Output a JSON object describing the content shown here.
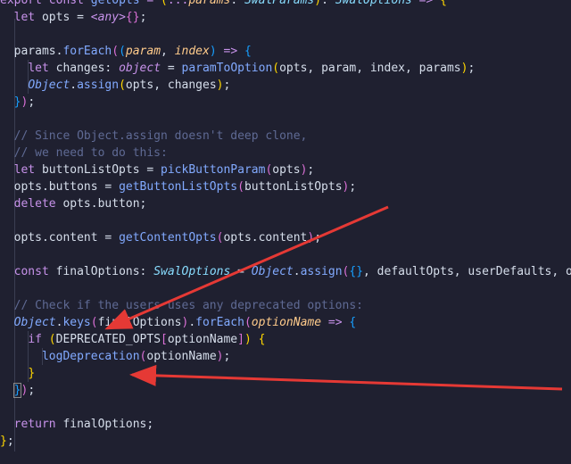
{
  "editor": {
    "theme_colors": {
      "background": "#1f2030",
      "keyword": "#c792ea",
      "function": "#82aaff",
      "type": "#89ddff",
      "parameter": "#ffcb8b",
      "comment": "#5f6a94",
      "annotation_arrow": "#e53935"
    },
    "lines": [
      [
        [
          "kw",
          "export"
        ],
        [
          "pl",
          " "
        ],
        [
          "kw",
          "const"
        ],
        [
          "pl",
          " "
        ],
        [
          "fn",
          "getOpts"
        ],
        [
          "pl",
          " "
        ],
        [
          "op",
          "="
        ],
        [
          "pl",
          " "
        ],
        [
          "pn",
          "("
        ],
        [
          "op",
          "..."
        ],
        [
          "par",
          "params"
        ],
        [
          "pl",
          ": "
        ],
        [
          "ty",
          "SwalParams"
        ],
        [
          "pn",
          ")"
        ],
        [
          "pl",
          ": "
        ],
        [
          "ty",
          "SwalOptions"
        ],
        [
          "pl",
          " "
        ],
        [
          "op",
          "=>"
        ],
        [
          "pl",
          " "
        ],
        [
          "pn",
          "{"
        ]
      ],
      [
        [
          "pl",
          "  "
        ],
        [
          "kw",
          "let"
        ],
        [
          "pl",
          " opts = "
        ],
        [
          "op",
          "<"
        ],
        [
          "kwi",
          "any"
        ],
        [
          "op",
          ">"
        ],
        [
          "pn2",
          "{}"
        ],
        [
          "pl",
          ";"
        ]
      ],
      [
        [
          "pl",
          ""
        ]
      ],
      [
        [
          "pl",
          "  params."
        ],
        [
          "fn",
          "forEach"
        ],
        [
          "pn2",
          "("
        ],
        [
          "pn3",
          "("
        ],
        [
          "par",
          "param"
        ],
        [
          "pl",
          ", "
        ],
        [
          "par",
          "index"
        ],
        [
          "pn3",
          ")"
        ],
        [
          "pl",
          " "
        ],
        [
          "op",
          "=>"
        ],
        [
          "pl",
          " "
        ],
        [
          "pn3",
          "{"
        ]
      ],
      [
        [
          "pl",
          "    "
        ],
        [
          "kw",
          "let"
        ],
        [
          "pl",
          " changes: "
        ],
        [
          "kwi",
          "object"
        ],
        [
          "pl",
          " = "
        ],
        [
          "fn",
          "paramToOption"
        ],
        [
          "pn",
          "("
        ],
        [
          "pl",
          "opts, param, index, params"
        ],
        [
          "pn",
          ")"
        ],
        [
          "pl",
          ";"
        ]
      ],
      [
        [
          "pl",
          "    "
        ],
        [
          "obj",
          "Object"
        ],
        [
          "pl",
          "."
        ],
        [
          "fn",
          "assign"
        ],
        [
          "pn",
          "("
        ],
        [
          "pl",
          "opts, changes"
        ],
        [
          "pn",
          ")"
        ],
        [
          "pl",
          ";"
        ]
      ],
      [
        [
          "pl",
          "  "
        ],
        [
          "pn3",
          "}"
        ],
        [
          "pn2",
          ")"
        ],
        [
          "pl",
          ";"
        ]
      ],
      [
        [
          "pl",
          ""
        ]
      ],
      [
        [
          "cm",
          "  // Since Object.assign doesn't deep clone,"
        ]
      ],
      [
        [
          "cm",
          "  // we need to do this:"
        ]
      ],
      [
        [
          "pl",
          "  "
        ],
        [
          "kw",
          "let"
        ],
        [
          "pl",
          " buttonListOpts = "
        ],
        [
          "fn",
          "pickButtonParam"
        ],
        [
          "pn2",
          "("
        ],
        [
          "pl",
          "opts"
        ],
        [
          "pn2",
          ")"
        ],
        [
          "pl",
          ";"
        ]
      ],
      [
        [
          "pl",
          "  opts.buttons = "
        ],
        [
          "fn",
          "getButtonListOpts"
        ],
        [
          "pn2",
          "("
        ],
        [
          "pl",
          "buttonListOpts"
        ],
        [
          "pn2",
          ")"
        ],
        [
          "pl",
          ";"
        ]
      ],
      [
        [
          "pl",
          "  "
        ],
        [
          "kw",
          "delete"
        ],
        [
          "pl",
          " opts.button;"
        ]
      ],
      [
        [
          "pl",
          ""
        ]
      ],
      [
        [
          "pl",
          "  opts.content = "
        ],
        [
          "fn",
          "getContentOpts"
        ],
        [
          "pn2",
          "("
        ],
        [
          "pl",
          "opts.content"
        ],
        [
          "pn2",
          ")"
        ],
        [
          "pl",
          ";"
        ]
      ],
      [
        [
          "pl",
          ""
        ]
      ],
      [
        [
          "pl",
          "  "
        ],
        [
          "kw",
          "const"
        ],
        [
          "pl",
          " finalOptions: "
        ],
        [
          "ty",
          "SwalOptions"
        ],
        [
          "pl",
          " = "
        ],
        [
          "obj",
          "Object"
        ],
        [
          "pl",
          "."
        ],
        [
          "fn",
          "assign"
        ],
        [
          "pn2",
          "("
        ],
        [
          "pn3",
          "{}"
        ],
        [
          "pl",
          ", defaultOpts, userDefaults, opts"
        ],
        [
          "pn2",
          ")"
        ],
        [
          "pl",
          ";"
        ]
      ],
      [
        [
          "pl",
          ""
        ]
      ],
      [
        [
          "cm",
          "  // Check if the users uses any deprecated options:"
        ]
      ],
      [
        [
          "pl",
          "  "
        ],
        [
          "obj",
          "Object"
        ],
        [
          "pl",
          "."
        ],
        [
          "fn",
          "keys"
        ],
        [
          "pn2",
          "("
        ],
        [
          "pl",
          "finalOptions"
        ],
        [
          "pn2",
          ")"
        ],
        [
          "pl",
          "."
        ],
        [
          "fn",
          "forEach"
        ],
        [
          "pn2",
          "("
        ],
        [
          "par",
          "optionName"
        ],
        [
          "pl",
          " "
        ],
        [
          "op",
          "=>"
        ],
        [
          "pl",
          " "
        ],
        [
          "pn3",
          "{"
        ]
      ],
      [
        [
          "pl",
          "    "
        ],
        [
          "kw",
          "if"
        ],
        [
          "pl",
          " "
        ],
        [
          "pn",
          "("
        ],
        [
          "pl",
          "DEPRECATED_OPTS"
        ],
        [
          "pn2",
          "["
        ],
        [
          "pl",
          "optionName"
        ],
        [
          "pn2",
          "]"
        ],
        [
          "pn",
          ")"
        ],
        [
          "pl",
          " "
        ],
        [
          "pn",
          "{"
        ]
      ],
      [
        [
          "pl",
          "      "
        ],
        [
          "fn",
          "logDeprecation"
        ],
        [
          "pn2",
          "("
        ],
        [
          "pl",
          "optionName"
        ],
        [
          "pn2",
          ")"
        ],
        [
          "pl",
          ";"
        ]
      ],
      [
        [
          "pl",
          "    "
        ],
        [
          "pn",
          "}"
        ]
      ],
      [
        [
          "pl",
          "  "
        ],
        [
          "pn3",
          "}"
        ],
        [
          "pn2",
          ")"
        ],
        [
          "pl",
          ";"
        ]
      ],
      [
        [
          "pl",
          ""
        ]
      ],
      [
        [
          "pl",
          "  "
        ],
        [
          "kw",
          "return"
        ],
        [
          "pl",
          " finalOptions;"
        ]
      ],
      [
        [
          "pn",
          "}"
        ],
        [
          "pl",
          ";"
        ]
      ]
    ]
  }
}
